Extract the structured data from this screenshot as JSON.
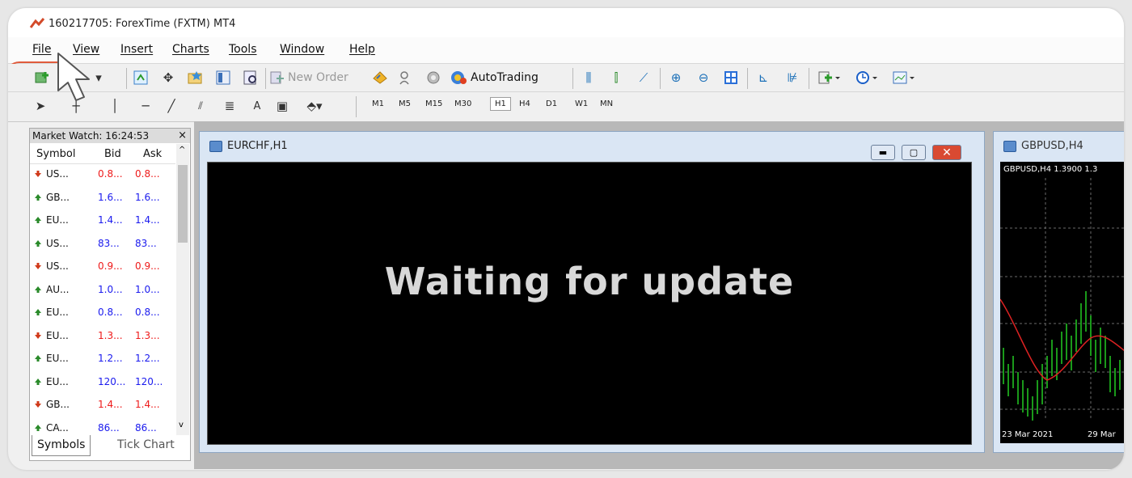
{
  "window": {
    "title": "160217705: ForexTime (FXTM) MT4"
  },
  "menu": [
    "File",
    "View",
    "Insert",
    "Charts",
    "Tools",
    "Window",
    "Help"
  ],
  "toolbar": {
    "new_order": "New Order",
    "autotrading": "AutoTrading",
    "text_tool": "A",
    "timeframes": [
      "M1",
      "M5",
      "M15",
      "M30",
      "H1",
      "H4",
      "D1",
      "W1",
      "MN"
    ],
    "active_timeframe": "H1"
  },
  "market_watch": {
    "title": "Market Watch: 16:24:53",
    "close": "×",
    "columns": [
      "Symbol",
      "Bid",
      "Ask"
    ],
    "rows": [
      {
        "symbol": "US...",
        "bid": "0.8...",
        "ask": "0.8...",
        "direction": "down"
      },
      {
        "symbol": "GB...",
        "bid": "1.6...",
        "ask": "1.6...",
        "direction": "up"
      },
      {
        "symbol": "EU...",
        "bid": "1.4...",
        "ask": "1.4...",
        "direction": "up"
      },
      {
        "symbol": "US...",
        "bid": "83...",
        "ask": "83...",
        "direction": "up"
      },
      {
        "symbol": "US...",
        "bid": "0.9...",
        "ask": "0.9...",
        "direction": "down"
      },
      {
        "symbol": "AU...",
        "bid": "1.0...",
        "ask": "1.0...",
        "direction": "up"
      },
      {
        "symbol": "EU...",
        "bid": "0.8...",
        "ask": "0.8...",
        "direction": "up"
      },
      {
        "symbol": "EU...",
        "bid": "1.3...",
        "ask": "1.3...",
        "direction": "down"
      },
      {
        "symbol": "EU...",
        "bid": "1.2...",
        "ask": "1.2...",
        "direction": "up"
      },
      {
        "symbol": "EU...",
        "bid": "120...",
        "ask": "120...",
        "direction": "up"
      },
      {
        "symbol": "GB...",
        "bid": "1.4...",
        "ask": "1.4...",
        "direction": "down"
      },
      {
        "symbol": "CA...",
        "bid": "86...",
        "ask": "86...",
        "direction": "up"
      }
    ],
    "tabs": [
      "Symbols",
      "Tick Chart"
    ]
  },
  "charts": [
    {
      "title": "EURCHF,H1",
      "message": "Waiting for update"
    },
    {
      "title": "GBPUSD,H4",
      "info": "GBPUSD,H4  1.3900 1.3",
      "dates": [
        "23 Mar 2021",
        "29 Mar"
      ]
    }
  ],
  "colors": {
    "up": "#2a8a2a",
    "down": "#d03a1a",
    "bid_up": "#1a1aee",
    "bid_down": "#ee1a1a",
    "highlight": "#e05b3c"
  }
}
